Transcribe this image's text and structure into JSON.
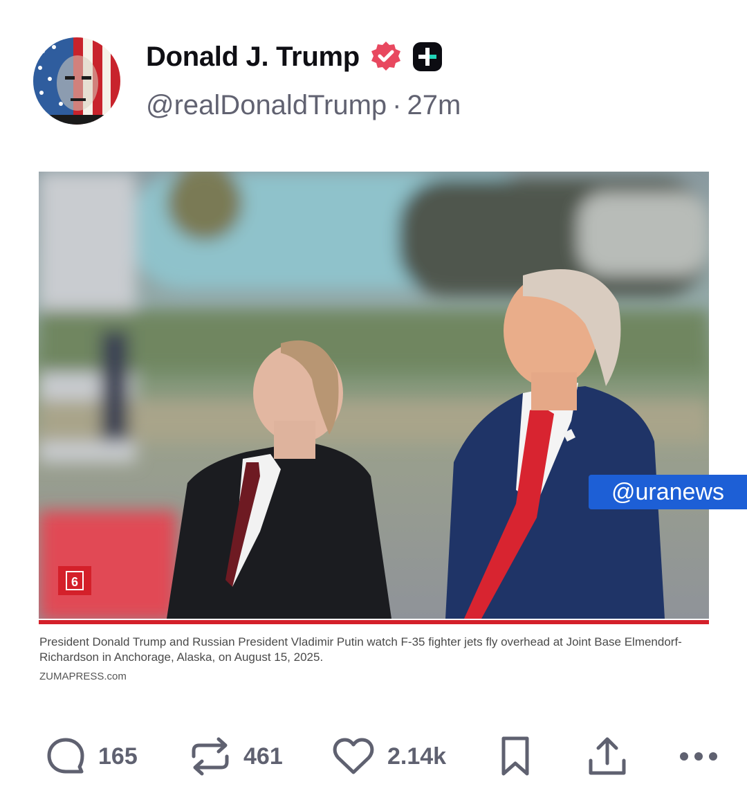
{
  "post": {
    "display_name": "Donald J. Trump",
    "handle": "@realDonaldTrump",
    "separator": "·",
    "time_ago": "27m",
    "icons": {
      "avatar": "avatar-flag-portrait",
      "verified": "verified-badge-icon",
      "plus": "plus-badge-icon"
    }
  },
  "media": {
    "logo_mark": "6",
    "caption": "President Donald Trump and Russian President Vladimir Putin watch F-35 fighter jets fly overhead at Joint Base Elmendorf-Richardson in Anchorage, Alaska, on August 15, 2025.",
    "credit": "ZUMAPRESS.com"
  },
  "watermark": "@uranews",
  "actions": {
    "replies": "165",
    "reposts": "461",
    "likes": "2.14k",
    "icons": [
      "reply-icon",
      "repost-icon",
      "like-icon",
      "bookmark-icon",
      "share-icon",
      "more-icon"
    ]
  },
  "colors": {
    "accent_red": "#d4202a",
    "verified_pink": "#e8485f",
    "watermark_blue": "#1d5fd6",
    "muted": "#616271"
  }
}
